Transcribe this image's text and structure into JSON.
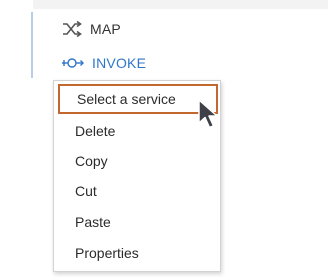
{
  "tree": {
    "items": [
      {
        "label": "MAP",
        "icon": "shuffle-icon"
      },
      {
        "label": "INVOKE",
        "icon": "invoke-service-icon"
      }
    ]
  },
  "context_menu": {
    "items": [
      {
        "label": "Select a service",
        "highlighted": true
      },
      {
        "label": "Delete"
      },
      {
        "label": "Copy"
      },
      {
        "label": "Cut"
      },
      {
        "label": "Paste"
      },
      {
        "label": "Properties"
      }
    ]
  },
  "colors": {
    "accent_blue": "#2e76c9",
    "highlight_border": "#c2682e",
    "panel_line": "#b9cde6"
  }
}
